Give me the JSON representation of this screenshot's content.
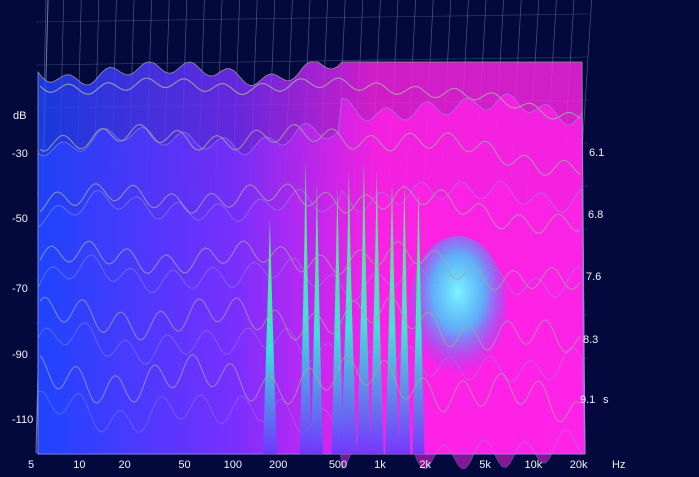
{
  "chart_data": {
    "type": "waterfall-spectrogram",
    "y_axis": {
      "unit": "dB",
      "ticks": [
        "-30",
        "-50",
        "-70",
        "-90",
        "-110"
      ]
    },
    "x_axis": {
      "unit": "Hz",
      "scale": "log",
      "range": [
        5,
        22000
      ],
      "ticks": [
        {
          "label": "5",
          "value": 5
        },
        {
          "label": "10",
          "value": 10
        },
        {
          "label": "20",
          "value": 20
        },
        {
          "label": "50",
          "value": 50
        },
        {
          "label": "100",
          "value": 100
        },
        {
          "label": "200",
          "value": 200
        },
        {
          "label": "500",
          "value": 500
        },
        {
          "label": "1k",
          "value": 1000
        },
        {
          "label": "2k",
          "value": 2000
        },
        {
          "label": "5k",
          "value": 5000
        },
        {
          "label": "10k",
          "value": 10000
        },
        {
          "label": "20k",
          "value": 20000
        }
      ]
    },
    "z_axis": {
      "unit": "s",
      "ticks": [
        "6.1",
        "6.8",
        "7.6",
        "8.3",
        "9.1"
      ]
    },
    "grid": true,
    "colors": {
      "background": "#03083d",
      "grid": "#5d7690",
      "low": "#2f48ff",
      "mid": "#8a32ff",
      "high": "#ff1ee8",
      "peak_green": "#35ff6d",
      "peak_cyan": "#3bf5ff",
      "trace": "#a4a4a4"
    }
  }
}
